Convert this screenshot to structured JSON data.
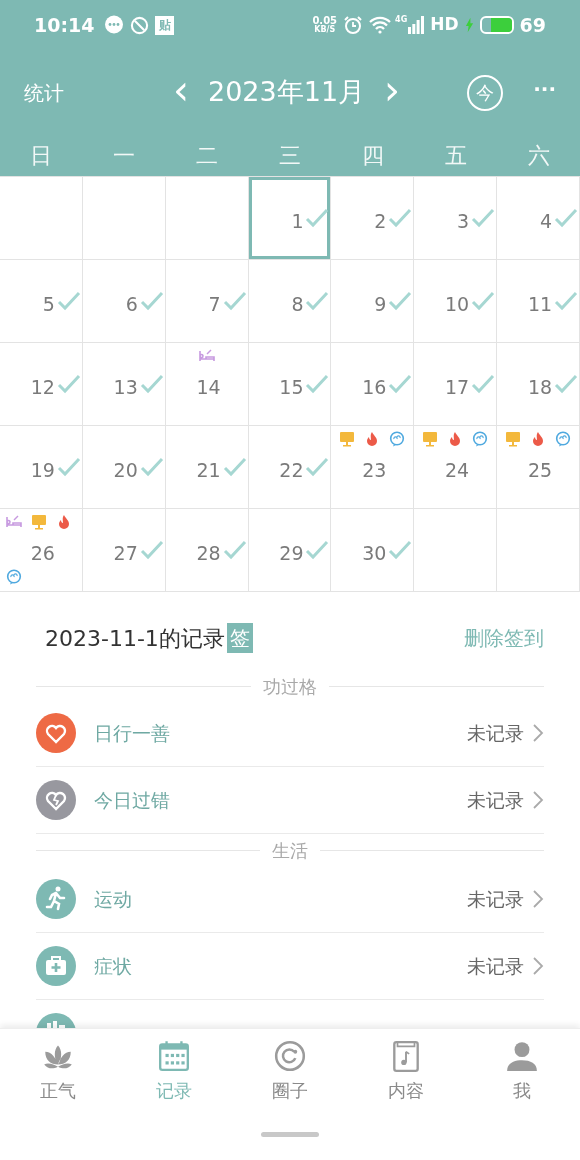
{
  "status_bar": {
    "time": "10:14",
    "notice_badge": "贴",
    "speed_value": "0.05",
    "speed_unit": "KB/S",
    "network": "4G",
    "hd": "HD",
    "battery": {
      "level": 0.69,
      "charging": true
    },
    "battery_text": "69"
  },
  "header": {
    "left": "统计",
    "prev": "‹",
    "month": "2023年11月",
    "next": "›",
    "today": "今",
    "more": "···"
  },
  "weekdays": [
    "日",
    "一",
    "二",
    "三",
    "四",
    "五",
    "六"
  ],
  "calendar": [
    {
      "kind": "blank"
    },
    {
      "kind": "blank"
    },
    {
      "kind": "blank"
    },
    {
      "kind": "day",
      "day": "1",
      "checked": true,
      "selected": true
    },
    {
      "kind": "day",
      "day": "2",
      "checked": true,
      "selected": false
    },
    {
      "kind": "day",
      "day": "3",
      "checked": true,
      "selected": false
    },
    {
      "kind": "day",
      "day": "4",
      "checked": true,
      "selected": false
    },
    {
      "kind": "day",
      "day": "5",
      "checked": true,
      "selected": false
    },
    {
      "kind": "day",
      "day": "6",
      "checked": true,
      "selected": false
    },
    {
      "kind": "day",
      "day": "7",
      "checked": true,
      "selected": false
    },
    {
      "kind": "day",
      "day": "8",
      "checked": true,
      "selected": false
    },
    {
      "kind": "day",
      "day": "9",
      "checked": true,
      "selected": false
    },
    {
      "kind": "day",
      "day": "10",
      "checked": true,
      "selected": false
    },
    {
      "kind": "day",
      "day": "11",
      "checked": true,
      "selected": false
    },
    {
      "kind": "day",
      "day": "12",
      "checked": true,
      "selected": false
    },
    {
      "kind": "day",
      "day": "13",
      "checked": true,
      "selected": false
    },
    {
      "kind": "day",
      "day": "14",
      "checked": false,
      "selected": false,
      "marks": [
        {
          "kind": "bed"
        }
      ]
    },
    {
      "kind": "day",
      "day": "15",
      "checked": true,
      "selected": false
    },
    {
      "kind": "day",
      "day": "16",
      "checked": true,
      "selected": false
    },
    {
      "kind": "day",
      "day": "17",
      "checked": true,
      "selected": false
    },
    {
      "kind": "day",
      "day": "18",
      "checked": true,
      "selected": false
    },
    {
      "kind": "day",
      "day": "19",
      "checked": true,
      "selected": false
    },
    {
      "kind": "day",
      "day": "20",
      "checked": true,
      "selected": false
    },
    {
      "kind": "day",
      "day": "21",
      "checked": true,
      "selected": false
    },
    {
      "kind": "day",
      "day": "22",
      "checked": true,
      "selected": false
    },
    {
      "kind": "day",
      "day": "23",
      "checked": false,
      "selected": false,
      "marks": [
        {
          "kind": "screen"
        },
        {
          "kind": "fire"
        },
        {
          "kind": "chat"
        }
      ]
    },
    {
      "kind": "day",
      "day": "24",
      "checked": false,
      "selected": false,
      "marks": [
        {
          "kind": "screen"
        },
        {
          "kind": "fire"
        },
        {
          "kind": "chat"
        }
      ]
    },
    {
      "kind": "day",
      "day": "25",
      "checked": false,
      "selected": false,
      "marks": [
        {
          "kind": "screen"
        },
        {
          "kind": "fire"
        },
        {
          "kind": "chat"
        }
      ]
    },
    {
      "kind": "day",
      "day": "26",
      "checked": false,
      "selected": false,
      "marks": [
        {
          "kind": "bed"
        },
        {
          "kind": "screen"
        },
        {
          "kind": "fire"
        },
        {
          "kind": "chat"
        }
      ]
    },
    {
      "kind": "day",
      "day": "27",
      "checked": true,
      "selected": false
    },
    {
      "kind": "day",
      "day": "28",
      "checked": true,
      "selected": false
    },
    {
      "kind": "day",
      "day": "29",
      "checked": true,
      "selected": false
    },
    {
      "kind": "day",
      "day": "30",
      "checked": true,
      "selected": false
    },
    {
      "kind": "blank"
    },
    {
      "kind": "blank"
    }
  ],
  "record": {
    "title": "2023-11-1的记录",
    "badge": "签",
    "action": "删除签到"
  },
  "sections": [
    {
      "title": "功过格",
      "items": [
        {
          "kind": "heart",
          "label": "日行一善",
          "value": "未记录"
        },
        {
          "kind": "broken-heart",
          "label": "今日过错",
          "value": "未记录"
        }
      ]
    },
    {
      "title": "生活",
      "items": [
        {
          "kind": "run",
          "label": "运动",
          "value": "未记录"
        },
        {
          "kind": "medkit",
          "label": "症状",
          "value": "未记录"
        },
        {
          "kind": "notes"
        }
      ]
    }
  ],
  "tabs": [
    {
      "kind": "lotus",
      "label": "正气",
      "selected": false
    },
    {
      "kind": "calendar",
      "label": "记录",
      "selected": true
    },
    {
      "kind": "ring",
      "label": "圈子",
      "selected": false
    },
    {
      "kind": "book",
      "label": "内容",
      "selected": false
    },
    {
      "kind": "person",
      "label": "我",
      "selected": false
    }
  ]
}
